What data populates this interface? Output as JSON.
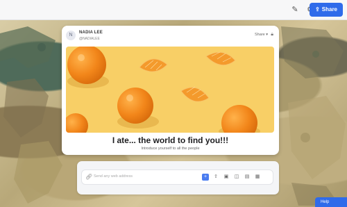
{
  "toolbar": {
    "share_label": "Share",
    "edit_icon": "pencil-icon",
    "settings_icon": "gear-icon"
  },
  "card": {
    "avatar_initial": "N",
    "user_name": "NADIA LEE",
    "user_handle": "@NADIALEE",
    "privacy_label": "Share",
    "title": "I ate... the world to find you!!!",
    "subtitle": "Introduce yourself to all the people"
  },
  "composer": {
    "placeholder": "Send any web address"
  },
  "help": {
    "label": "Help"
  },
  "colors": {
    "accent": "#2f6bea",
    "image_bg": "#f8cf66",
    "orange": "#f08a1c"
  }
}
